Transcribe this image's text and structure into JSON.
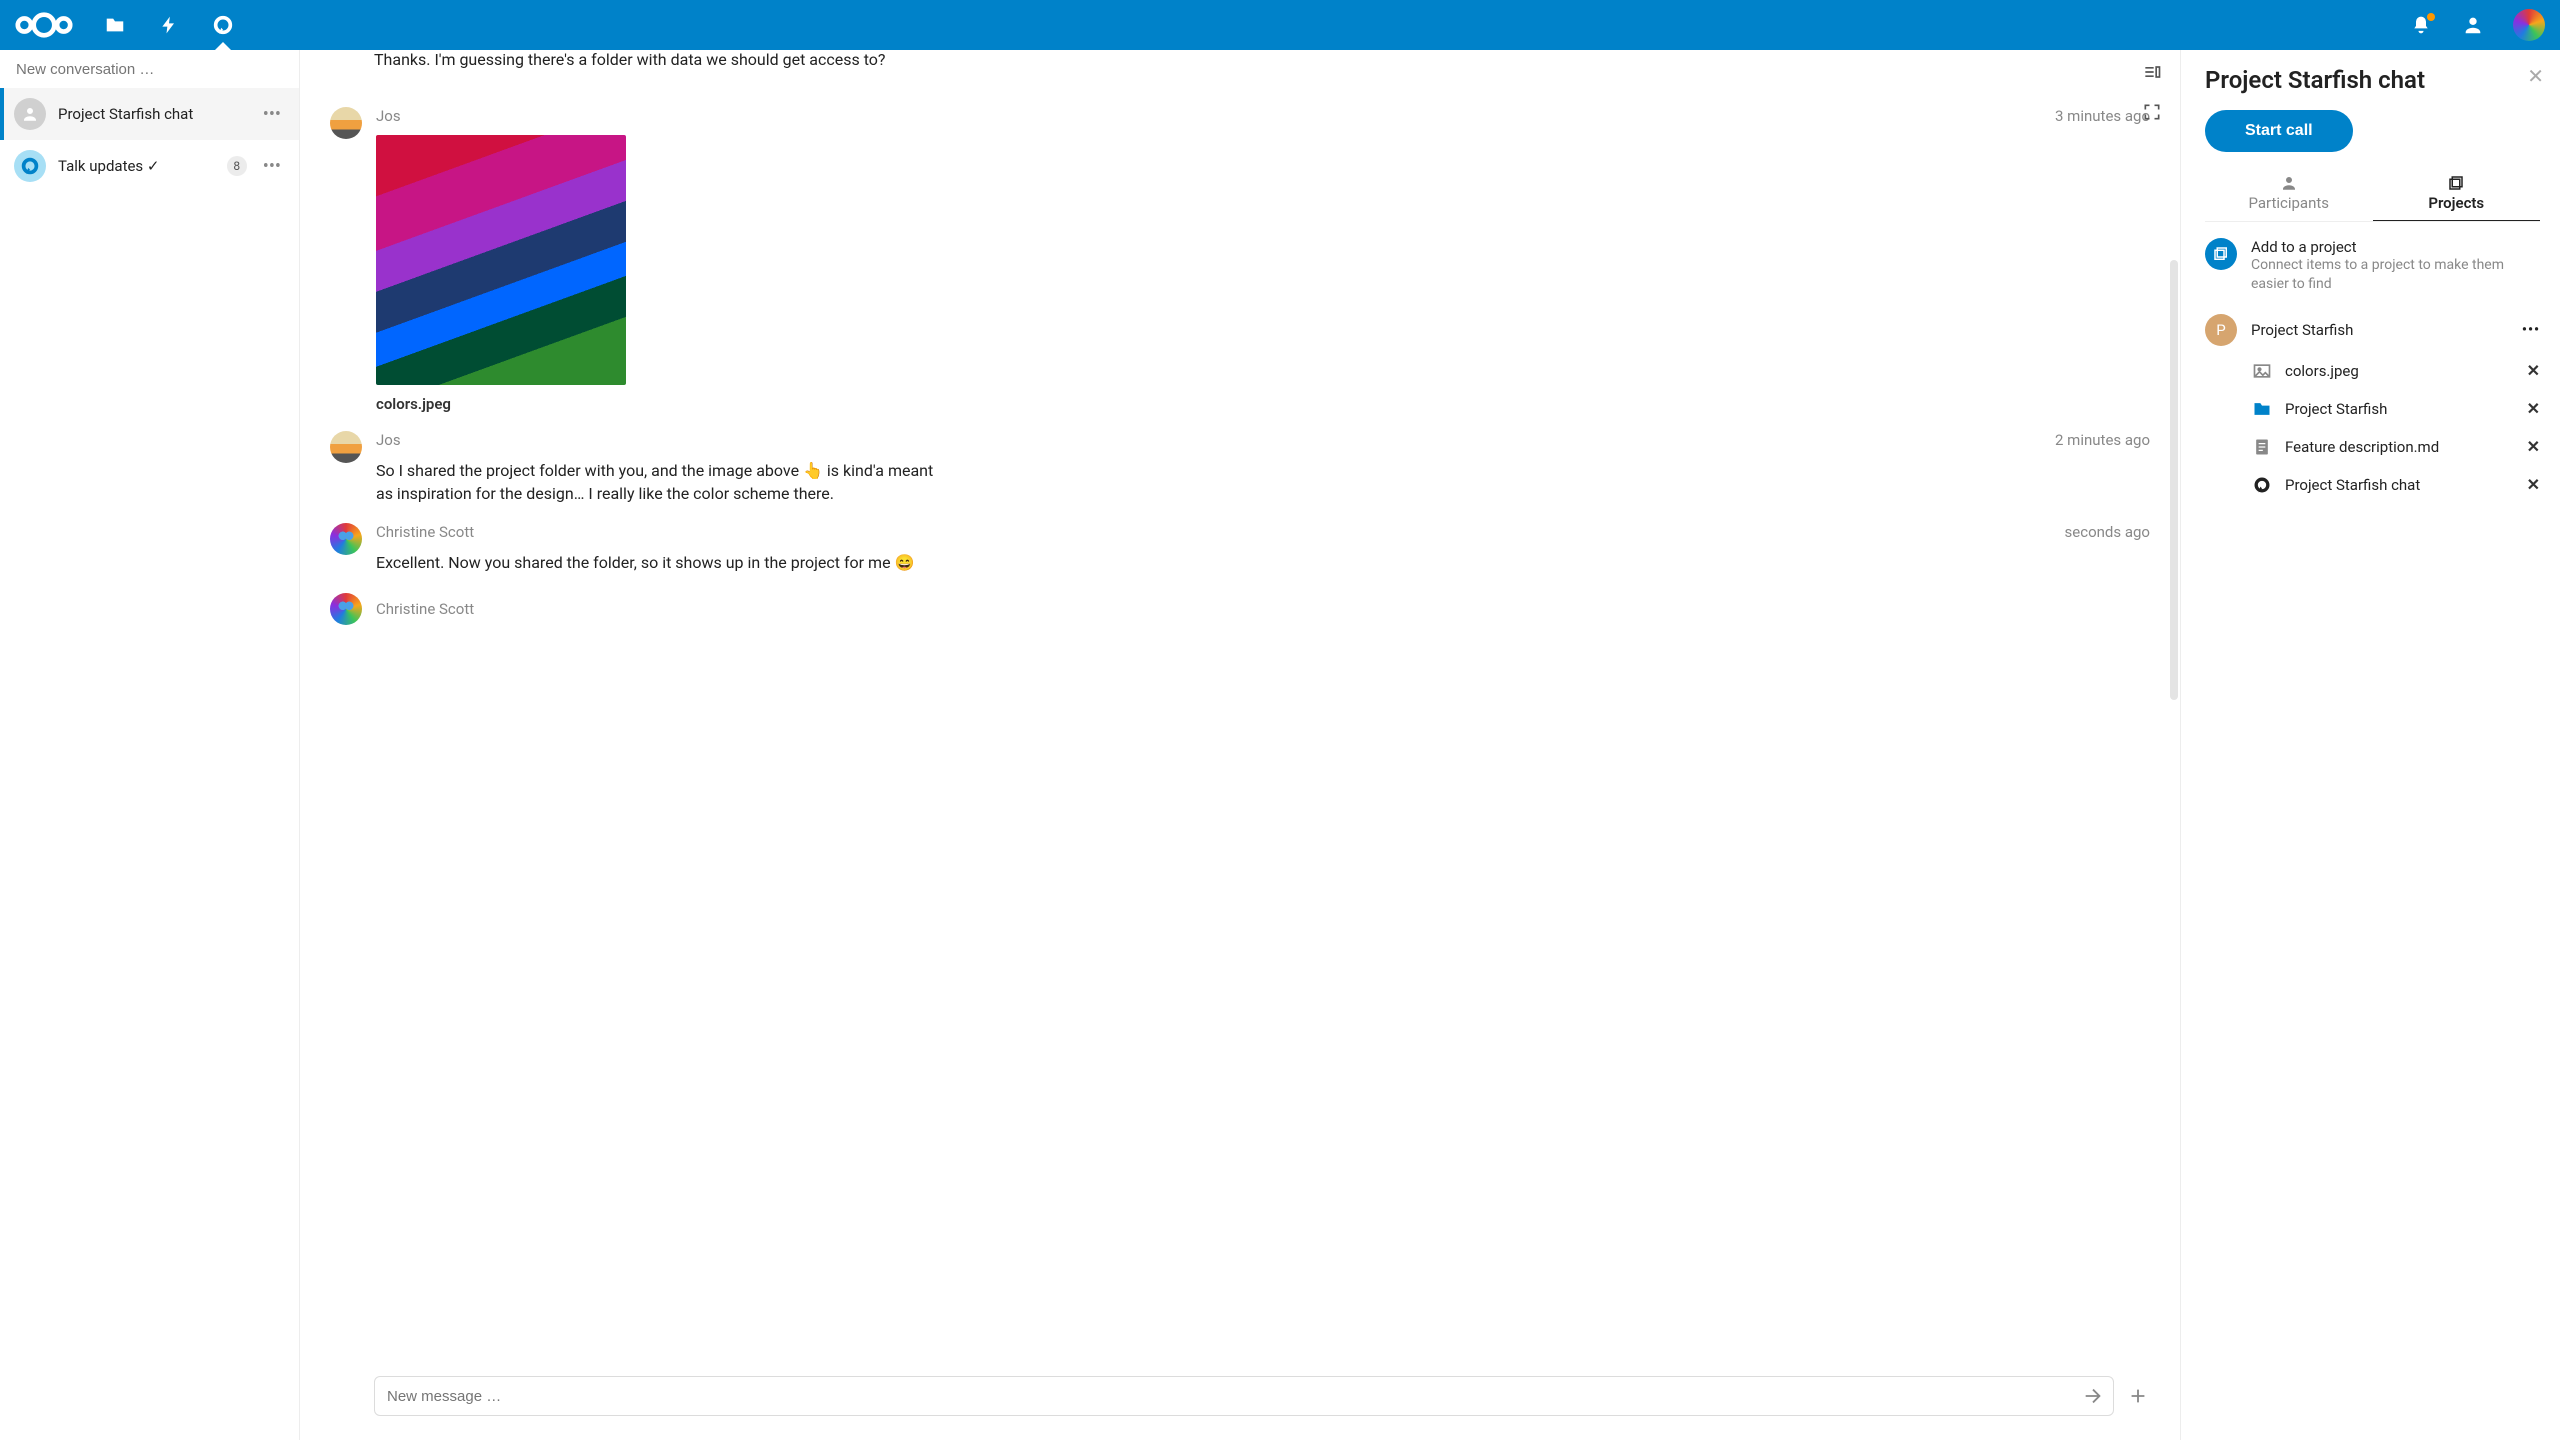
{
  "header": {
    "icons": [
      "files",
      "activity",
      "talk"
    ],
    "active_icon": "talk"
  },
  "sidebar": {
    "search_placeholder": "New conversation …",
    "conversations": [
      {
        "title": "Project Starfish chat",
        "unread": "",
        "active": true,
        "avatar": "group"
      },
      {
        "title": "Talk updates ✓",
        "unread": "8",
        "active": false,
        "avatar": "talk"
      }
    ]
  },
  "chat": {
    "partial_prev": "Thanks. I'm guessing there's a folder with data we should get access to?",
    "messages": [
      {
        "author": "Jos",
        "avatar": "jos",
        "time": "3 minutes ago",
        "file": {
          "name": "colors.jpeg"
        }
      },
      {
        "author": "Jos",
        "avatar": "jos",
        "time": "2 minutes ago",
        "text": "So I shared the project folder with you, and the image above 👆 is kind'a meant as inspiration for the design… I really like the color scheme there."
      },
      {
        "author": "Christine Scott",
        "avatar": "cs",
        "time": "seconds ago",
        "text": "Excellent. Now you shared the folder, so it shows up in the project for me 😄"
      }
    ],
    "typing": {
      "author": "Christine Scott",
      "avatar": "cs"
    },
    "composer_placeholder": "New message …"
  },
  "details": {
    "title": "Project Starfish chat",
    "start_call_label": "Start call",
    "tabs": {
      "participants": "Participants",
      "projects": "Projects",
      "active": "Projects"
    },
    "add_project": {
      "title": "Add to a project",
      "subtitle": "Connect items to a project to make them easier to find"
    },
    "project": {
      "letter": "P",
      "name": "Project Starfish"
    },
    "project_items": [
      {
        "icon": "image",
        "label": "colors.jpeg"
      },
      {
        "icon": "folder",
        "label": "Project Starfish"
      },
      {
        "icon": "doc",
        "label": "Feature description.md"
      },
      {
        "icon": "talk",
        "label": "Project Starfish chat"
      }
    ]
  }
}
